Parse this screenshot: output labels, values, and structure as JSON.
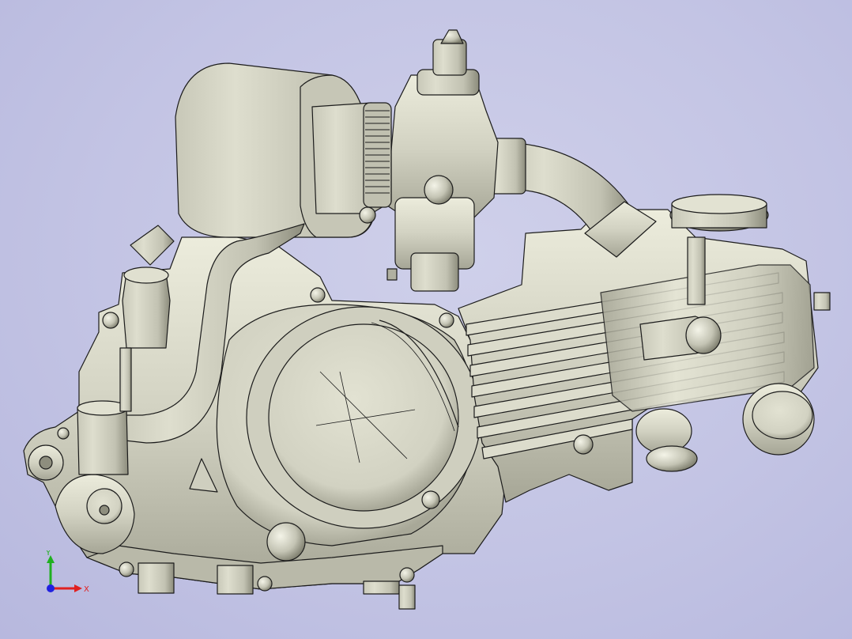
{
  "viewport": {
    "background": "#c3c4e4",
    "model_fill": "#d4d4c4",
    "model_shadow": "#8e8e7e",
    "edge_color": "#1c1c1c"
  },
  "triad": {
    "x_label": "X",
    "y_label": "Y",
    "x_color": "#e02020",
    "y_color": "#20b020",
    "z_color": "#2020e0"
  }
}
